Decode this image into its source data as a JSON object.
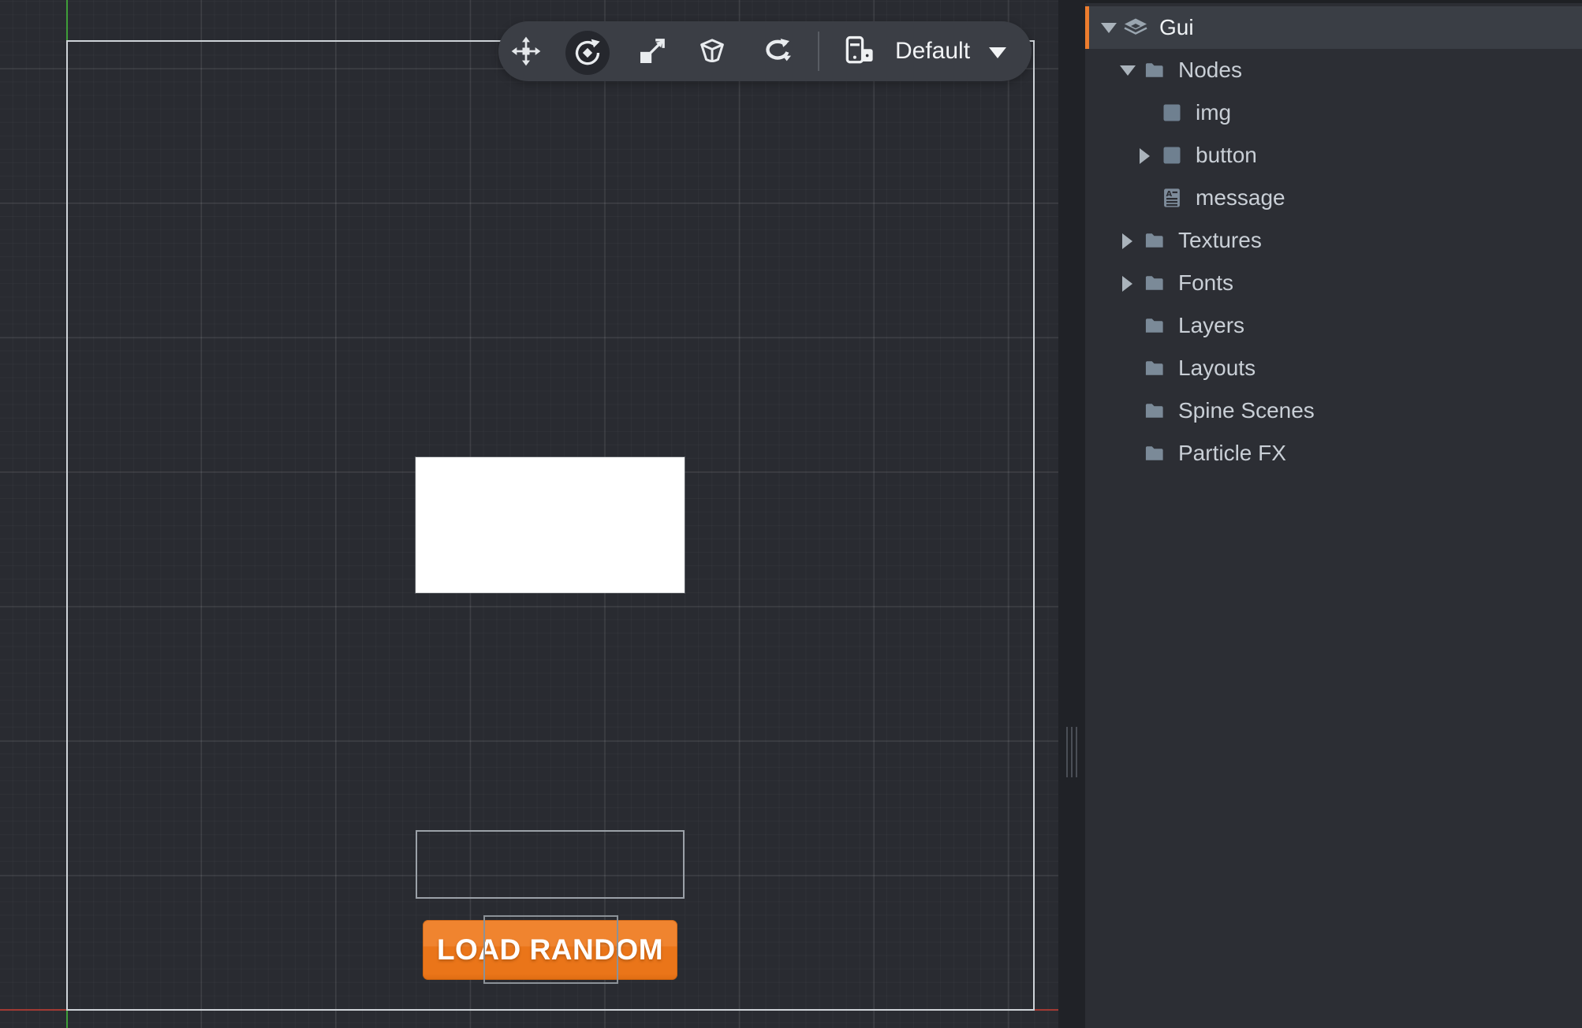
{
  "toolbar": {
    "tools": [
      {
        "name": "move-tool",
        "icon": "move-icon",
        "active": false
      },
      {
        "name": "rotate-tool",
        "icon": "rotate-icon",
        "active": true
      },
      {
        "name": "scale-tool",
        "icon": "scale-icon",
        "active": false
      },
      {
        "name": "frustum-tool",
        "icon": "frustum-icon",
        "active": false
      },
      {
        "name": "rotation-cycle-tool",
        "icon": "rotation-cycle-icon",
        "active": false
      }
    ],
    "layout_selector": {
      "icon": "device-icon",
      "value": "Default",
      "dropdown_icon": "chevron-down-icon"
    }
  },
  "canvas": {
    "nodes": {
      "img": {
        "type": "box",
        "fill": "#ffffff"
      },
      "message": {
        "type": "text",
        "text": ""
      },
      "button": {
        "type": "box",
        "label": "LOAD RANDOM"
      }
    },
    "button_label": "LOAD RANDOM",
    "axis_colors": {
      "x": "#a23a33",
      "y": "#3f9e39"
    },
    "frame_color": "#ced3d8",
    "button_colors": {
      "top": "#f0842f",
      "bottom": "#ea7519"
    }
  },
  "sidebar": {
    "accent_color": "#ed7d2e",
    "tree": [
      {
        "label": "Gui",
        "level": 0,
        "icon": "gui-scene-icon",
        "caret": "down",
        "selected": true
      },
      {
        "label": "Nodes",
        "level": 1,
        "icon": "folder-icon",
        "caret": "down",
        "selected": false
      },
      {
        "label": "img",
        "level": 2,
        "icon": "box-node-icon",
        "caret": "none",
        "selected": false
      },
      {
        "label": "button",
        "level": 2,
        "icon": "box-node-icon",
        "caret": "right",
        "selected": false
      },
      {
        "label": "message",
        "level": 2,
        "icon": "text-node-icon",
        "caret": "none",
        "selected": false
      },
      {
        "label": "Textures",
        "level": 1,
        "icon": "folder-icon",
        "caret": "right",
        "selected": false
      },
      {
        "label": "Fonts",
        "level": 1,
        "icon": "folder-icon",
        "caret": "right",
        "selected": false
      },
      {
        "label": "Layers",
        "level": 1,
        "icon": "folder-icon",
        "caret": "none",
        "selected": false
      },
      {
        "label": "Layouts",
        "level": 1,
        "icon": "folder-icon",
        "caret": "none",
        "selected": false
      },
      {
        "label": "Spine Scenes",
        "level": 1,
        "icon": "folder-icon",
        "caret": "none",
        "selected": false
      },
      {
        "label": "Particle FX",
        "level": 1,
        "icon": "folder-icon",
        "caret": "none",
        "selected": false
      }
    ]
  }
}
